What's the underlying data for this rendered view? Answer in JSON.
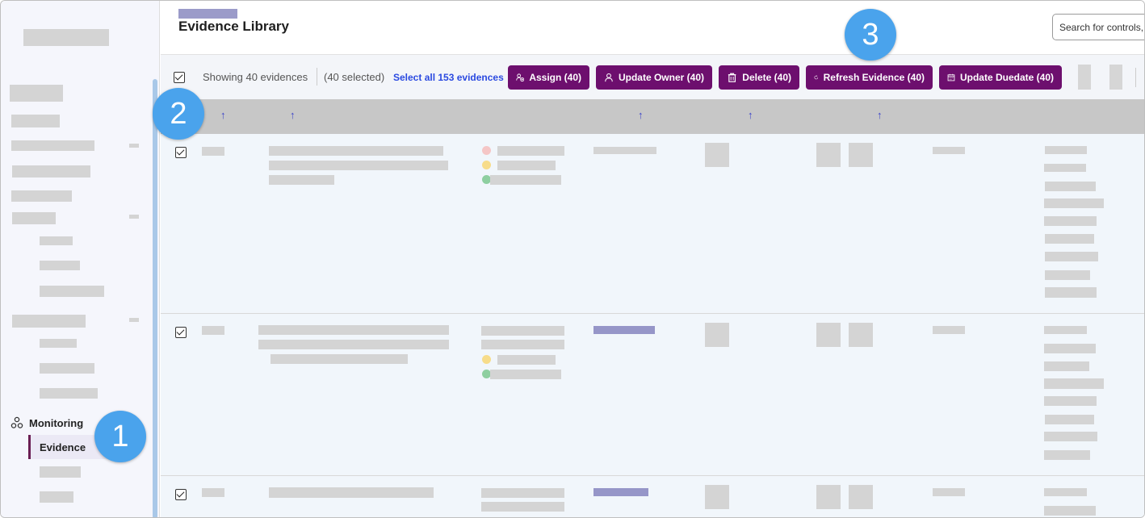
{
  "sidebar": {
    "section_label": "Monitoring",
    "active_item": "Evidence"
  },
  "header": {
    "title": "Evidence Library",
    "search_placeholder": "Search for controls,"
  },
  "toolbar": {
    "showing": "Showing 40 evidences",
    "selected": "(40 selected)",
    "select_all": "Select all 153 evidences",
    "buttons": [
      {
        "label": "Assign (40)",
        "icon": "assign-icon"
      },
      {
        "label": "Update Owner (40)",
        "icon": "user-icon"
      },
      {
        "label": "Delete (40)",
        "icon": "trash-icon"
      },
      {
        "label": "Refresh Evidence (40)",
        "icon": "refresh-icon"
      },
      {
        "label": "Update Duedate (40)",
        "icon": "calendar-icon"
      }
    ]
  },
  "sort_arrow": "↑",
  "badges": [
    "1",
    "2",
    "3"
  ],
  "colors": {
    "button_bg": "#6d0f6e",
    "accent_link": "#2a49e0",
    "badge": "#4aa3ec",
    "active_bar": "#6a1e53"
  }
}
